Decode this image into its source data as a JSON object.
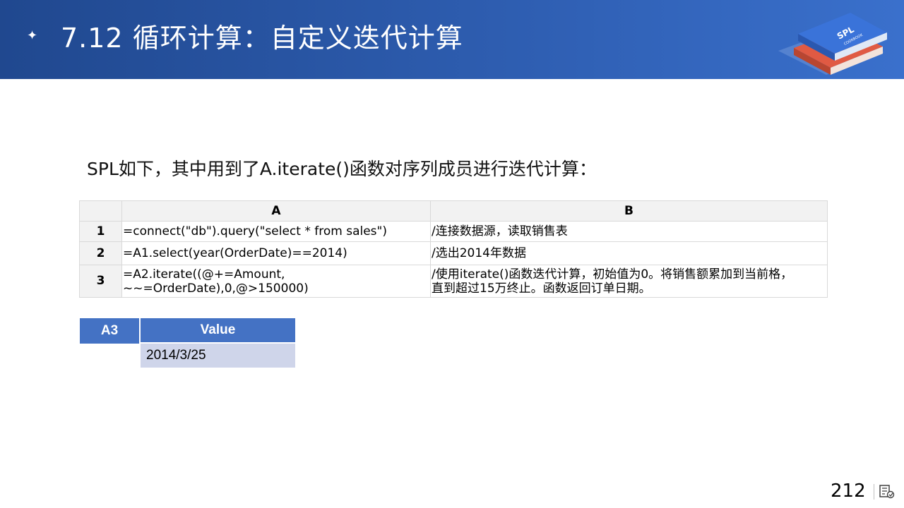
{
  "header": {
    "title": "7.12  循环计算：自定义迭代计算",
    "bullet_icon": "four-point-star-icon",
    "logo": {
      "text": "SPL",
      "subtext": "COOKBOOK"
    }
  },
  "intro": "SPL如下，其中用到了A.iterate()函数对序列成员进行迭代计算：",
  "grid": {
    "columns": [
      "A",
      "B"
    ],
    "rows": [
      {
        "num": "1",
        "a": "=connect(\"db\").query(\"select * from sales\")",
        "b": "/连接数据源，读取销售表"
      },
      {
        "num": "2",
        "a": "=A1.select(year(OrderDate)==2014)",
        "b": "/选出2014年数据"
      },
      {
        "num": "3",
        "a_lines": [
          "=A2.iterate((@+=Amount,",
          "~~=OrderDate),0,@>150000)"
        ],
        "b_lines": [
          "/使用iterate()函数迭代计算，初始值为0。将销售额累加到当前格，",
          "直到超过15万终止。函数返回订单日期。"
        ]
      }
    ]
  },
  "result": {
    "cell": "A3",
    "header": "Value",
    "value": "2014/3/25"
  },
  "footer": {
    "page_number": "212",
    "icon": "notes-icon"
  },
  "colors": {
    "banner": "#2f5fb3",
    "result_header": "#4472c4",
    "result_value_bg": "#cfd5ea",
    "grid_header_bg": "#f2f2f2"
  }
}
